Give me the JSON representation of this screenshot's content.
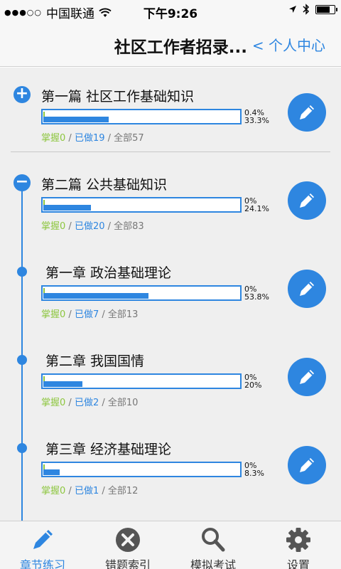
{
  "status_bar": {
    "signal": "●●●○○",
    "carrier": "中国联通",
    "time": "下午9:26"
  },
  "nav": {
    "title": "社区工作者招录...",
    "back_label": "< 个人中心"
  },
  "colors": {
    "accent": "#2e86e0",
    "mastered": "#8dc63f",
    "muted": "#777777"
  },
  "items": [
    {
      "kind": "section",
      "title": "第一篇 社区工作基础知识",
      "mastered_pct": "0.4%",
      "done_pct": "33.3%",
      "mastered_fraction": 0.004,
      "done_fraction": 0.333,
      "mastered_label": "掌握0",
      "done_label": "已做19",
      "total_label": "全部57"
    },
    {
      "kind": "section-open",
      "title": "第二篇 公共基础知识",
      "mastered_pct": "0%",
      "done_pct": "24.1%",
      "mastered_fraction": 0,
      "done_fraction": 0.241,
      "mastered_label": "掌握0",
      "done_label": "已做20",
      "total_label": "全部83"
    },
    {
      "kind": "chapter",
      "title": "第一章 政治基础理论",
      "mastered_pct": "0%",
      "done_pct": "53.8%",
      "mastered_fraction": 0,
      "done_fraction": 0.538,
      "mastered_label": "掌握0",
      "done_label": "已做7",
      "total_label": "全部13"
    },
    {
      "kind": "chapter",
      "title": "第二章 我国国情",
      "mastered_pct": "0%",
      "done_pct": "20%",
      "mastered_fraction": 0,
      "done_fraction": 0.2,
      "mastered_label": "掌握0",
      "done_label": "已做2",
      "total_label": "全部10"
    },
    {
      "kind": "chapter",
      "title": "第三章 经济基础理论",
      "mastered_pct": "0%",
      "done_pct": "8.3%",
      "mastered_fraction": 0,
      "done_fraction": 0.083,
      "mastered_label": "掌握0",
      "done_label": "已做1",
      "total_label": "全部12"
    }
  ],
  "tabs": [
    {
      "label": "章节练习",
      "icon": "pencil-icon",
      "active": true
    },
    {
      "label": "错题索引",
      "icon": "close-circle-icon",
      "active": false
    },
    {
      "label": "模拟考试",
      "icon": "search-icon",
      "active": false
    },
    {
      "label": "设置",
      "icon": "gear-icon",
      "active": false
    }
  ]
}
